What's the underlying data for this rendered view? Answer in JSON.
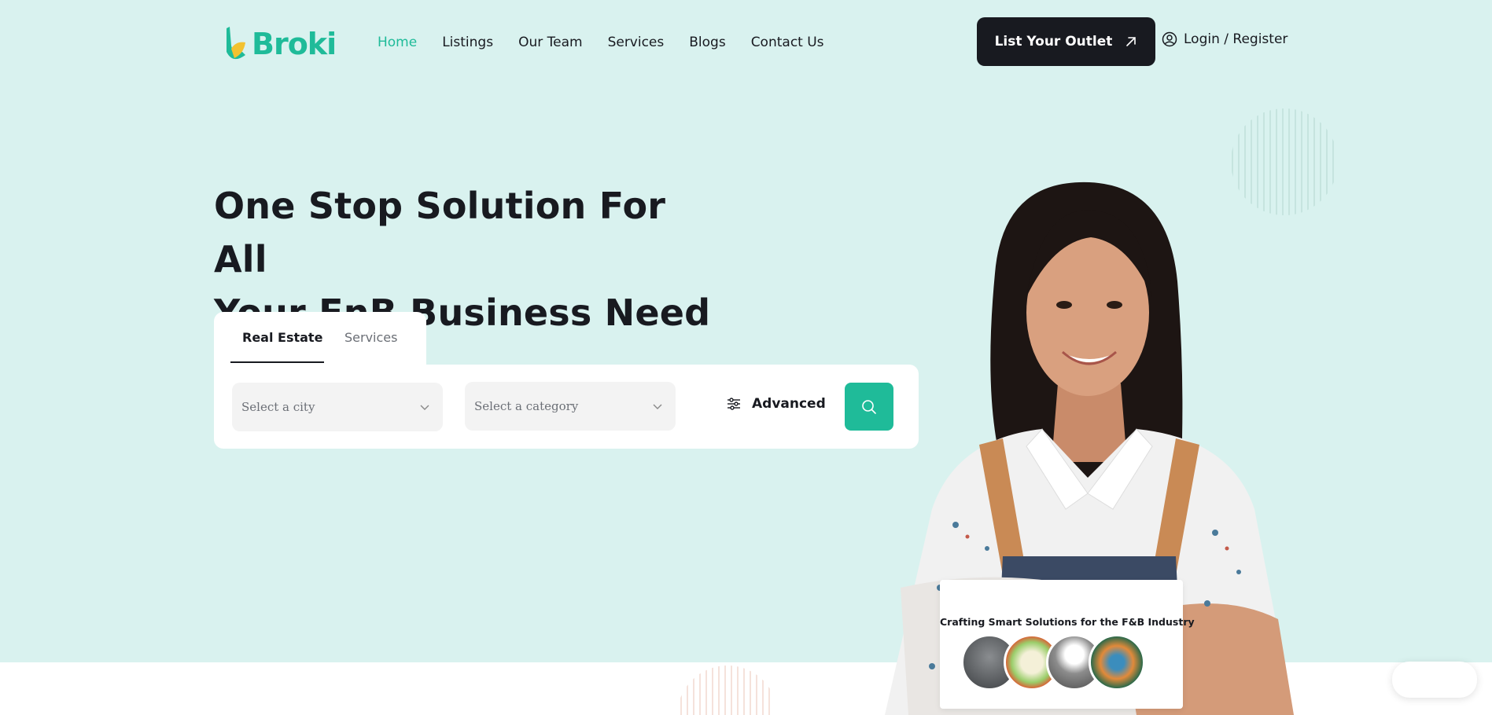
{
  "brand": {
    "name": "Broki",
    "accent": "#1fbb99",
    "dark": "#181a20",
    "hero_bg": "#d9f2ef"
  },
  "nav": {
    "items": [
      {
        "label": "Home",
        "active": true
      },
      {
        "label": "Listings"
      },
      {
        "label": "Our Team"
      },
      {
        "label": "Services"
      },
      {
        "label": "Blogs"
      },
      {
        "label": "Contact Us"
      }
    ]
  },
  "header": {
    "list_outlet_label": "List Your Outlet",
    "list_outlet_icon": "arrow-up-right-icon",
    "login_label": "Login / Register",
    "login_icon": "user-circle-icon"
  },
  "hero": {
    "headline_line1": "One Stop Solution For All",
    "headline_line2": "Your FnB Business Need"
  },
  "search": {
    "tabs": [
      {
        "label": "Real Estate",
        "active": true
      },
      {
        "label": "Services"
      }
    ],
    "city_placeholder": "Select a city",
    "category_placeholder": "Select a category",
    "advanced_label": "Advanced",
    "advanced_icon": "sliders-icon",
    "search_icon": "search-icon"
  },
  "promo": {
    "title": "Crafting Smart Solutions for the F&B Industry"
  }
}
